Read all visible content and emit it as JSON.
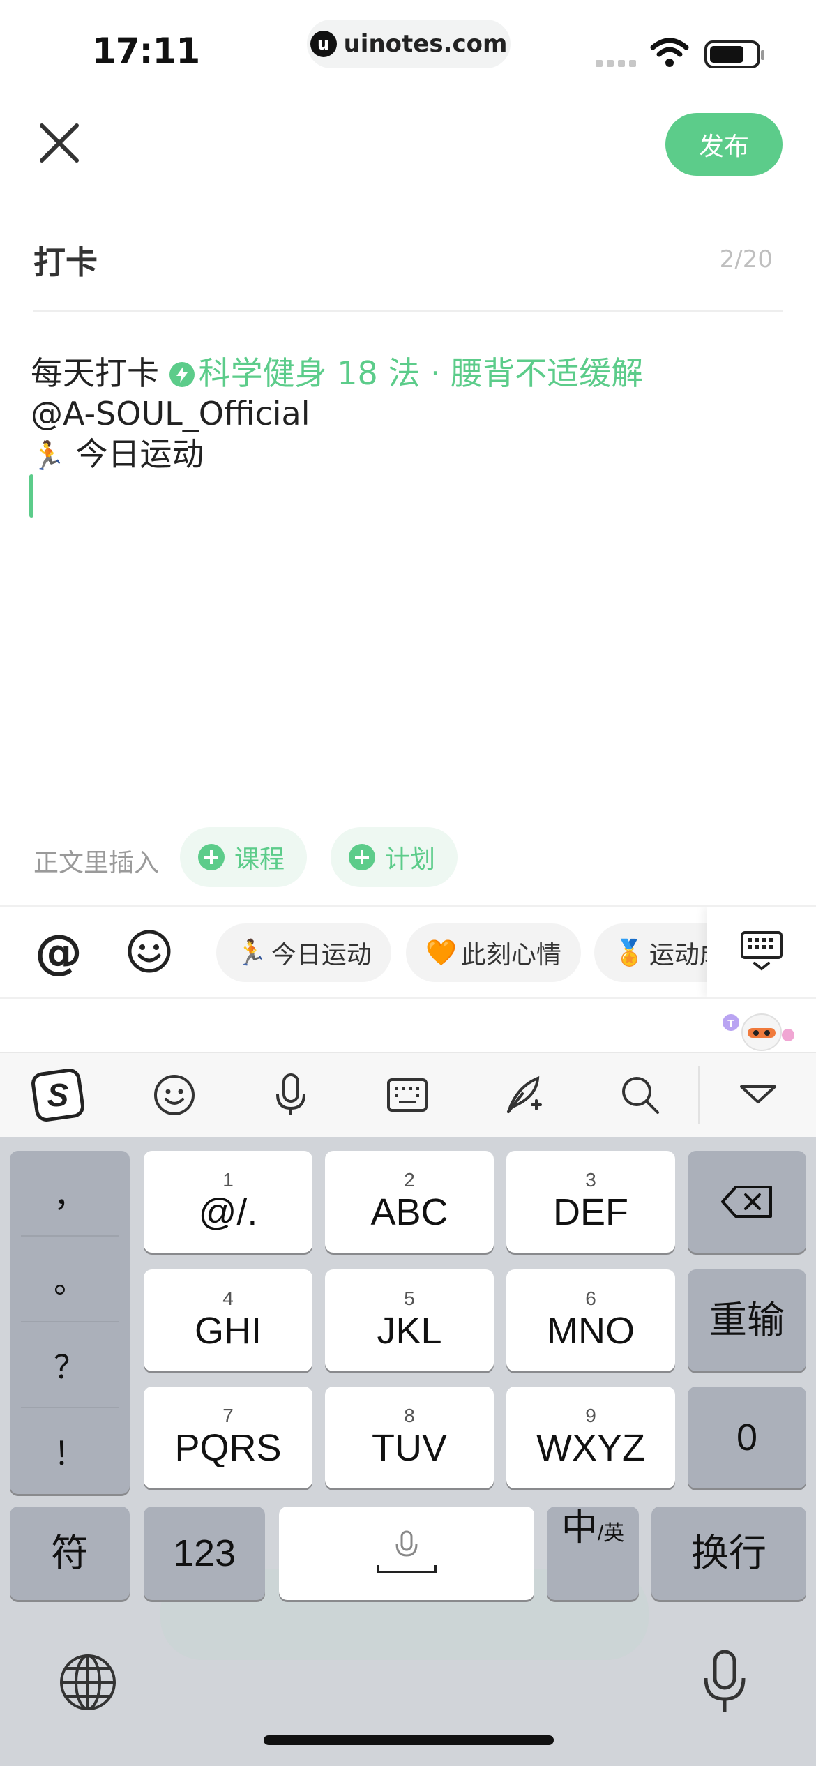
{
  "status_bar": {
    "time": "17:11",
    "url": "uinotes.com",
    "url_logo": "u"
  },
  "top_bar": {
    "publish_label": "发布"
  },
  "title": {
    "text": "打卡",
    "count": "2/20"
  },
  "body": {
    "line1_prefix": "每天打卡",
    "course_name": "科学健身 18 法 · 腰背不适缓解",
    "mention": "@A-SOUL_Official",
    "line3_emoji": "🏃",
    "line3_text": "今日运动"
  },
  "insert_row": {
    "label": "正文里插入",
    "chips": [
      {
        "label": "课程"
      },
      {
        "label": "计划"
      }
    ]
  },
  "tool_row": {
    "at_label": "@",
    "tags": [
      {
        "emoji": "🏃",
        "label": "今日运动"
      },
      {
        "emoji": "🧡",
        "label": "此刻心情"
      },
      {
        "emoji": "🏅",
        "label": "运动成"
      }
    ]
  },
  "keyboard": {
    "punctuation": [
      "，",
      "。",
      "？",
      "！"
    ],
    "keys": [
      {
        "num": "1",
        "label": "@/."
      },
      {
        "num": "2",
        "label": "ABC"
      },
      {
        "num": "3",
        "label": "DEF"
      },
      {
        "num": "4",
        "label": "GHI"
      },
      {
        "num": "5",
        "label": "JKL"
      },
      {
        "num": "6",
        "label": "MNO"
      },
      {
        "num": "7",
        "label": "PQRS"
      },
      {
        "num": "8",
        "label": "TUV"
      },
      {
        "num": "9",
        "label": "WXYZ"
      }
    ],
    "retype_label": "重输",
    "zero_label": "0",
    "symbol_label": "符",
    "number_label": "123",
    "lang_main": "中",
    "lang_sub": "/英",
    "return_label": "换行"
  },
  "colors": {
    "accent": "#5ccc8a",
    "keyboard_bg": "#d1d4d9",
    "dark_key": "#abb0ba"
  }
}
